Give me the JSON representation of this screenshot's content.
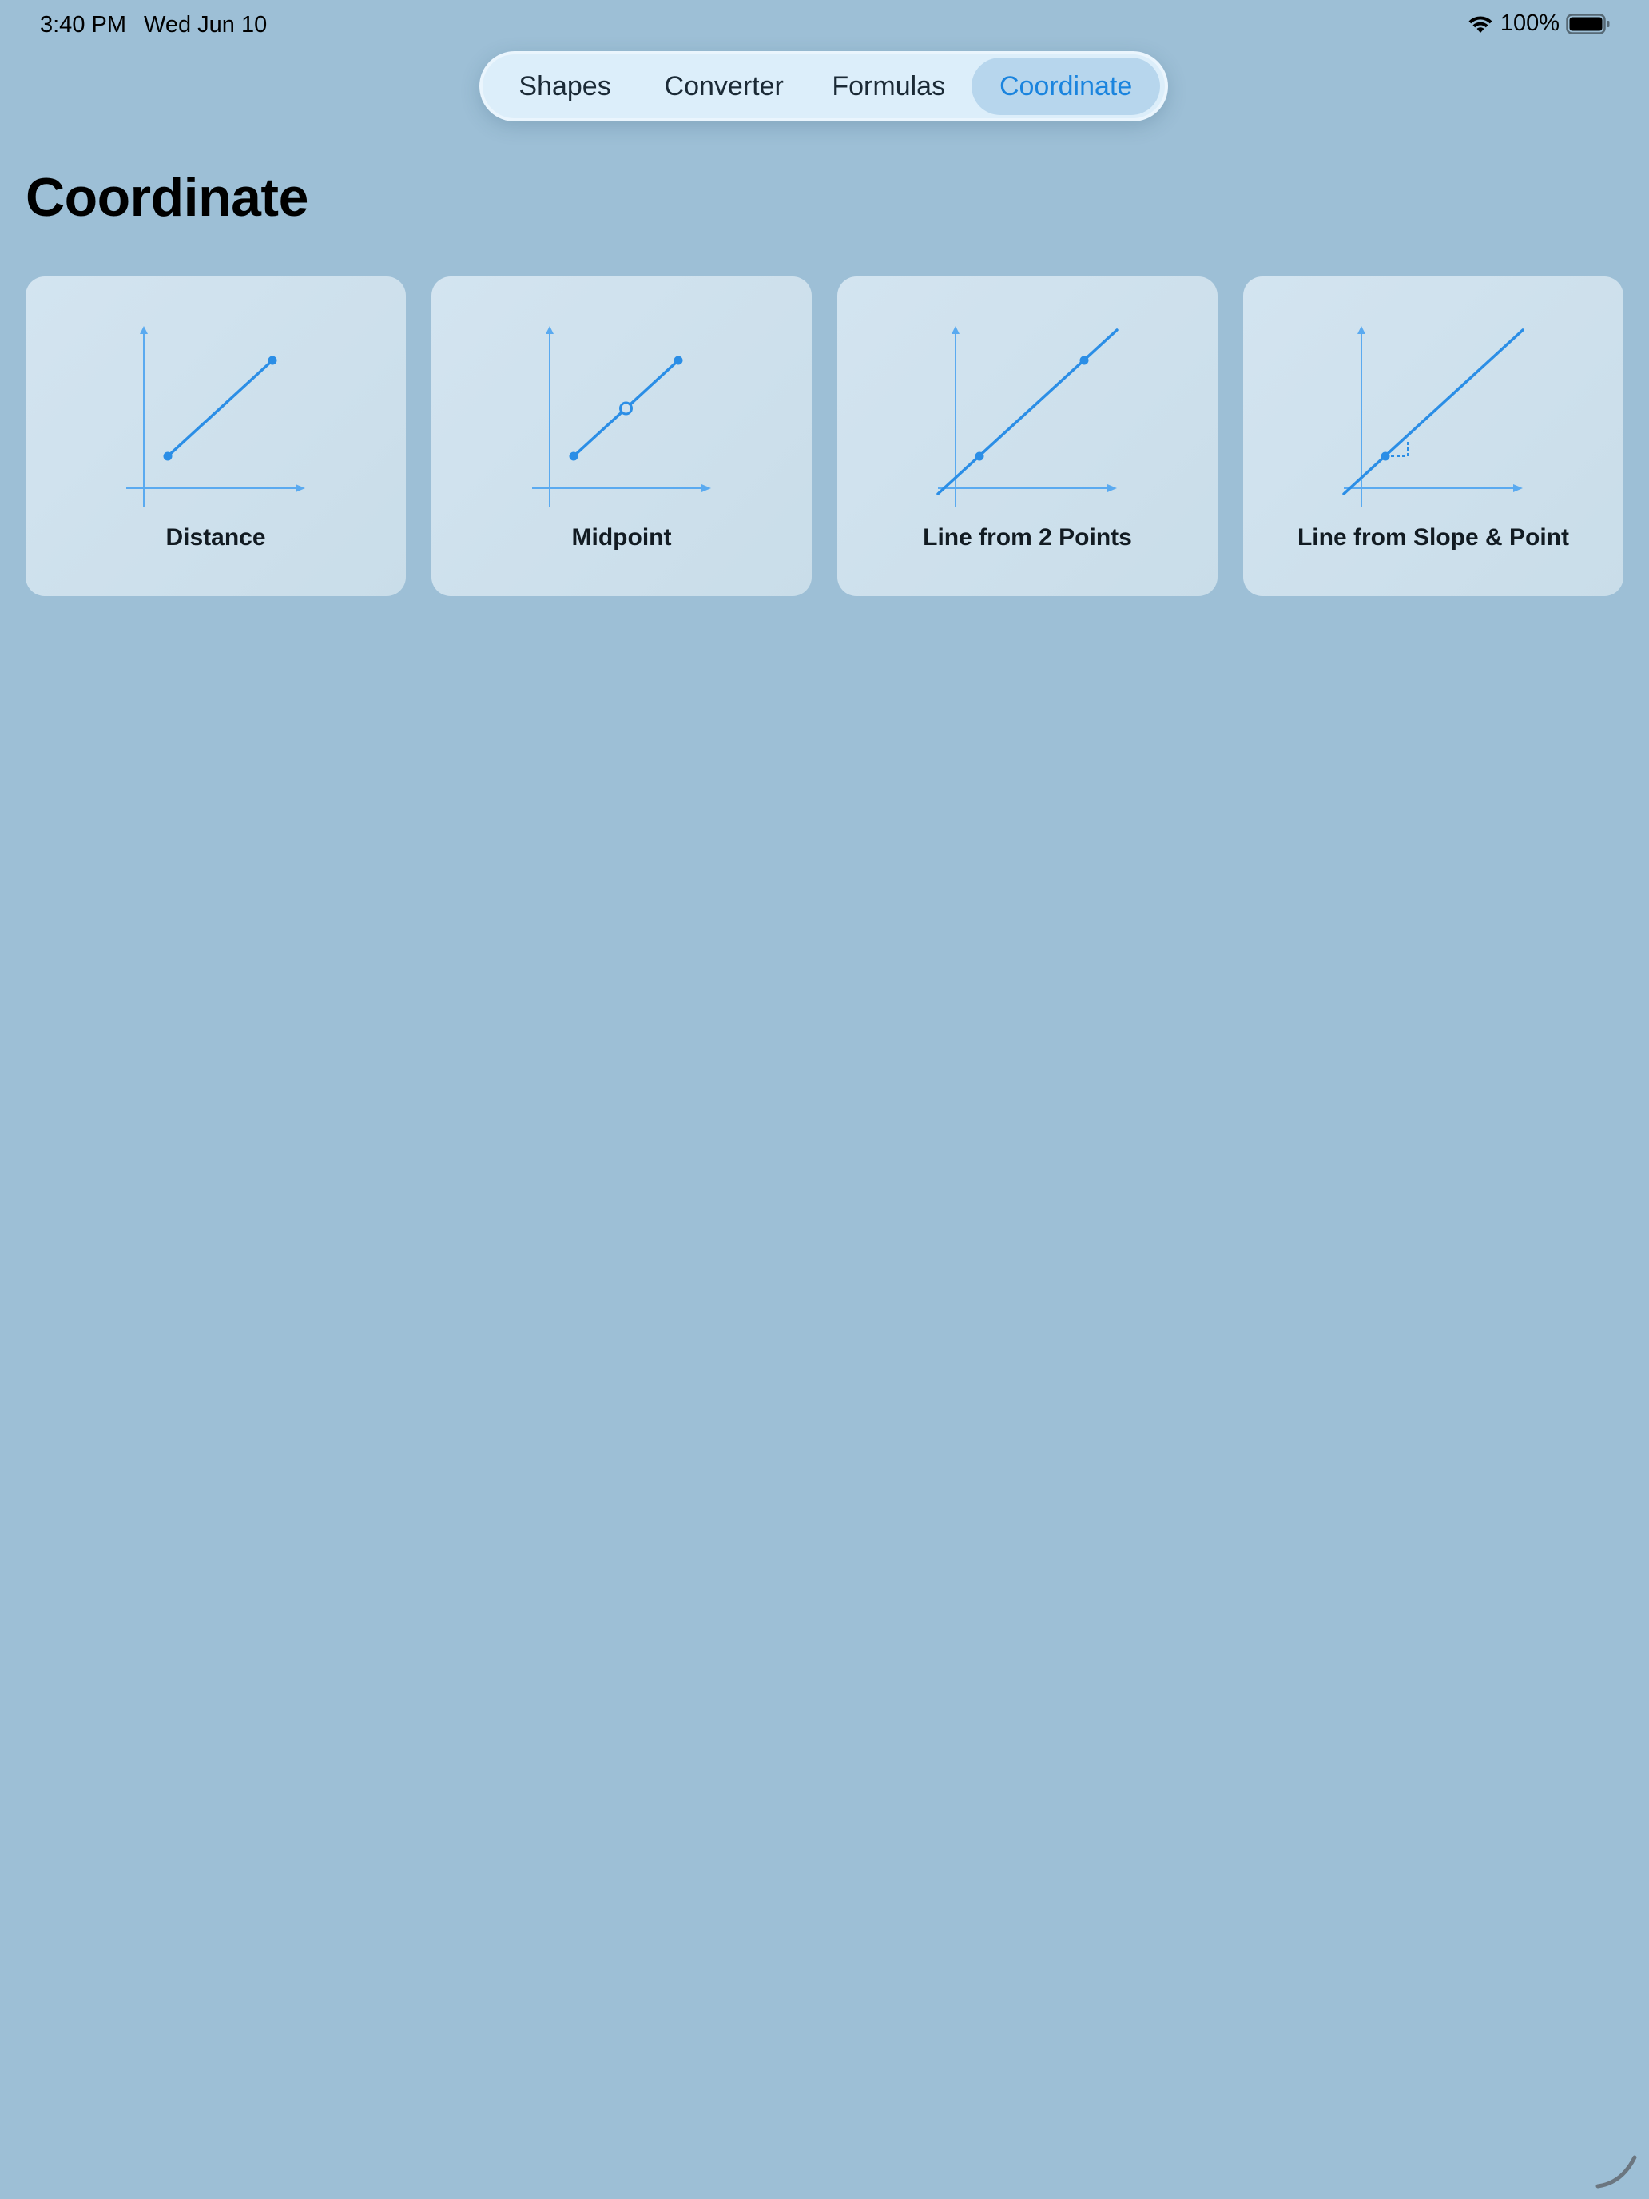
{
  "status_bar": {
    "time": "3:40 PM",
    "date": "Wed Jun 10",
    "battery": "100%"
  },
  "tabs": [
    {
      "label": "Shapes",
      "active": false
    },
    {
      "label": "Converter",
      "active": false
    },
    {
      "label": "Formulas",
      "active": false
    },
    {
      "label": "Coordinate",
      "active": true
    }
  ],
  "page": {
    "title": "Coordinate"
  },
  "cards": [
    {
      "label": "Distance",
      "icon": "distance-graph-icon"
    },
    {
      "label": "Midpoint",
      "icon": "midpoint-graph-icon"
    },
    {
      "label": "Line from 2 Points",
      "icon": "line-two-points-graph-icon"
    },
    {
      "label": "Line from Slope & Point",
      "icon": "line-slope-point-graph-icon"
    }
  ],
  "colors": {
    "background": "#9dbfd6",
    "accent": "#1a84de",
    "graph_line": "#2b8ee6",
    "axis": "#5aaaf0"
  }
}
